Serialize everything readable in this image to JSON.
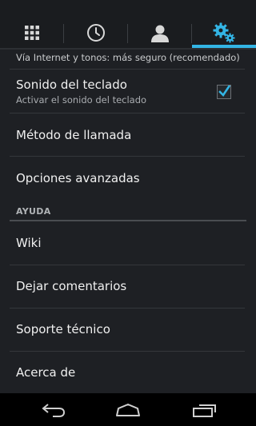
{
  "tabs": [
    {
      "icon": "dialpad-icon"
    },
    {
      "icon": "clock-icon"
    },
    {
      "icon": "contact-icon"
    },
    {
      "icon": "settings-icon",
      "active": true
    }
  ],
  "partial_text": "Vía Internet y tonos: más seguro (recomendado)",
  "keypad_sound": {
    "title": "Sonido del teclado",
    "subtitle": "Activar el sonido del teclado",
    "checked": true
  },
  "items": {
    "call_method": "Método de llamada",
    "advanced": "Opciones avanzadas"
  },
  "help_section": {
    "header": "AYUDA",
    "wiki": "Wiki",
    "feedback": "Dejar comentarios",
    "support": "Soporte técnico",
    "about": "Acerca de"
  },
  "colors": {
    "accent": "#33b5e5",
    "background": "#1e2024",
    "navbar": "#000000"
  },
  "navbar": {
    "buttons": [
      "back-icon",
      "home-icon",
      "recent-apps-icon"
    ]
  }
}
